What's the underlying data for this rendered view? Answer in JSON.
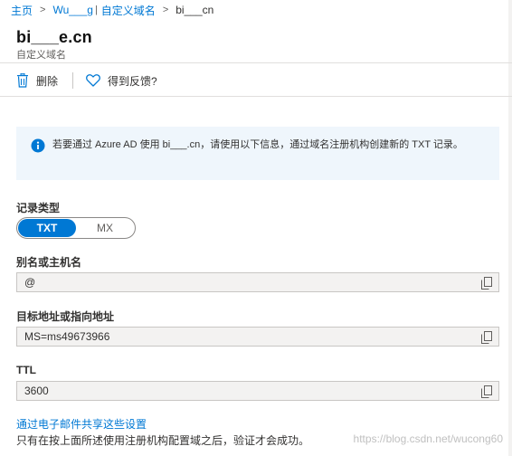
{
  "breadcrumb": {
    "home": "主页",
    "directory": "Wu___g",
    "custom_domains": "自定义域名",
    "current": "bi___cn"
  },
  "header": {
    "title": "bi___e.cn",
    "subtitle": "自定义域名"
  },
  "toolbar": {
    "delete_label": "删除",
    "feedback_label": "得到反馈?"
  },
  "info": {
    "text": "若要通过 Azure AD 使用 bi___.cn，请使用以下信息，通过域名注册机构创建新的 TXT 记录。"
  },
  "record_type": {
    "label": "记录类型",
    "options": [
      "TXT",
      "MX"
    ],
    "selected": "TXT"
  },
  "alias": {
    "label": "别名或主机名",
    "value": "@"
  },
  "target": {
    "label": "目标地址或指向地址",
    "value": "MS=ms49673966"
  },
  "ttl": {
    "label": "TTL",
    "value": "3600"
  },
  "email_link": "通过电子邮件共享这些设置",
  "footnote": "只有在按上面所述使用注册机构配置域之后，验证才会成功。",
  "watermark": "https://blog.csdn.net/wucong60",
  "colors": {
    "accent": "#0078d4",
    "info_bg": "#eff6fc",
    "field_bg": "#f3f2f1"
  },
  "icons": {
    "delete": "trash-icon",
    "feedback": "heart-icon",
    "info": "info-circle-icon",
    "copy": "copy-icon",
    "separator": "chevron-right-icon"
  }
}
